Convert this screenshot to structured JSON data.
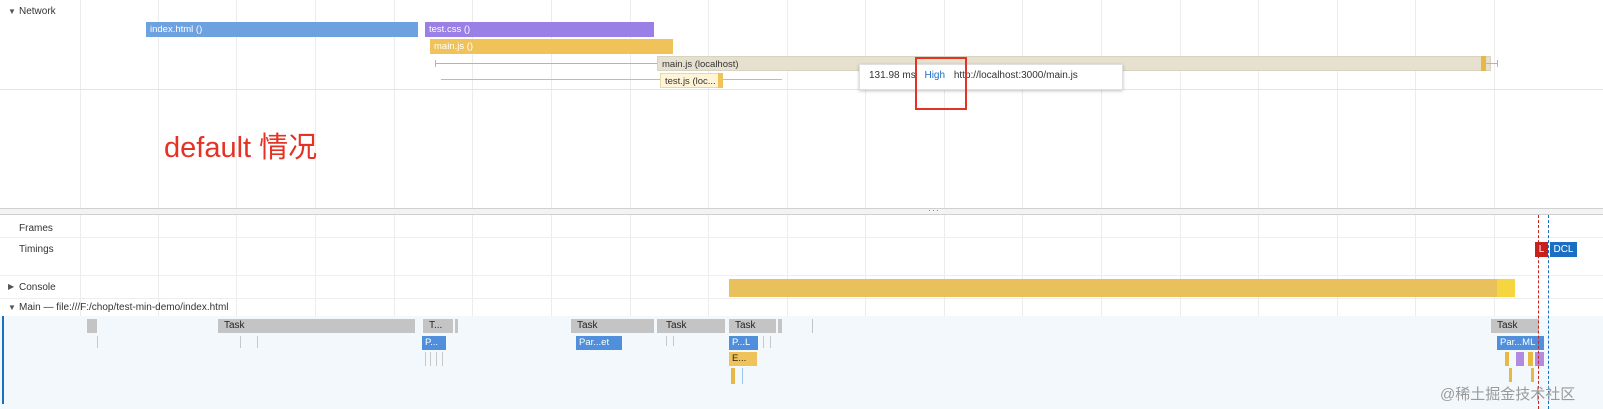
{
  "network": {
    "label": "Network",
    "requests": [
      {
        "label": "index.html ()",
        "color": "#6ea1e0"
      },
      {
        "label": "test.css ()",
        "color": "#9a7fe6"
      },
      {
        "label": "main.js ()",
        "color": "#f0c35a"
      },
      {
        "label": "main.js (localhost)",
        "color": "#e6e0cf"
      },
      {
        "label": "test.js (loc...",
        "color": "#f0c35a"
      }
    ],
    "tooltip": {
      "time": "131.98 ms",
      "priority": "High",
      "url": "http://localhost:3000/main.js"
    }
  },
  "annotation": {
    "text": "default 情况"
  },
  "tracks": {
    "frames": "Frames",
    "timings": "Timings",
    "console": "Console",
    "main": "Main — file:///F:/chop/test-min-demo/index.html"
  },
  "timings_markers": {
    "l": "L",
    "dcl": "DCL"
  },
  "main_tasks": {
    "task1": "Task",
    "task2": "T...",
    "task3": "Task",
    "task4": "Task",
    "task5": "Task",
    "task6": "Task",
    "sub1": "P...",
    "sub2": "Par...et",
    "sub3": "P...L",
    "sub4": "E...",
    "sub5": "Par...ML"
  },
  "watermark": "@稀土掘金技术社区",
  "colors": {
    "annotation": "#e53225",
    "highlight_box": "#e53225",
    "marker_l": "#c8201c",
    "marker_dcl": "#1a6fc4"
  }
}
